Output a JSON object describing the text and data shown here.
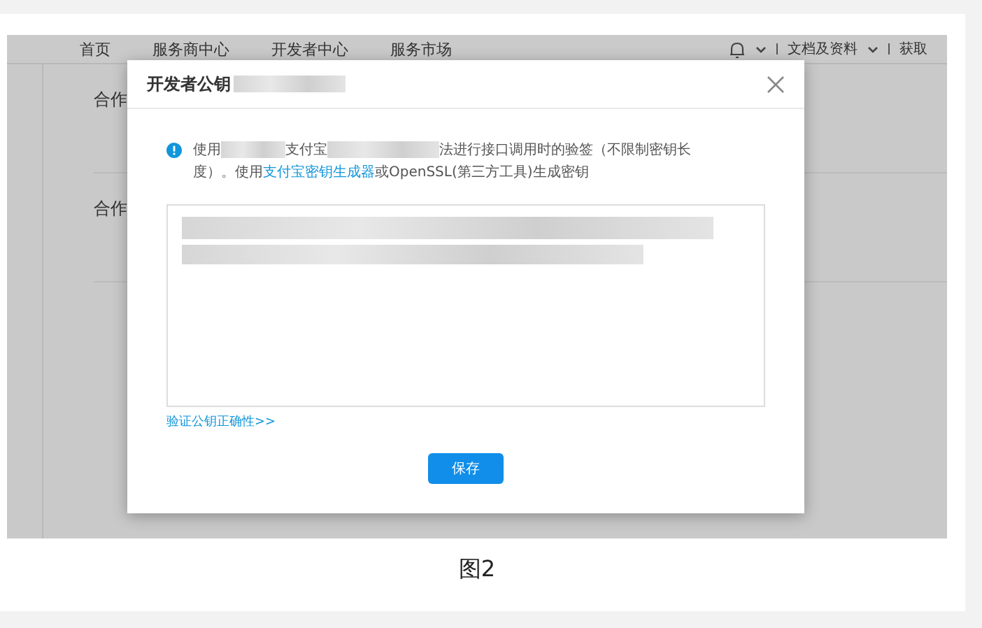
{
  "screenshot": {
    "nav": {
      "items": [
        "首页",
        "服务商中心",
        "开发者中心",
        "服务市场"
      ],
      "right_items": [
        "文档及资料",
        "获取"
      ]
    },
    "page_labels": [
      "合作",
      "合作"
    ],
    "dialog": {
      "title": "开发者公钥",
      "notice": {
        "part_1": "使用",
        "part_2": "支付宝",
        "part_3": "法进行接口调用时的验签（不限制密钥长",
        "part_3b": "度）。使用",
        "link": "支付宝密钥生成器",
        "part_4": "或OpenSSL(第三方工具)生成密钥"
      },
      "verify_link": "验证公钥正确性>>",
      "save_button": "保存"
    }
  },
  "caption": "图2"
}
